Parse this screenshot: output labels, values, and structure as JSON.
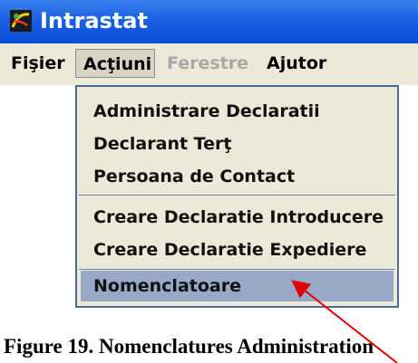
{
  "window": {
    "title": "Intrastat",
    "icon": "app-logo-icon"
  },
  "menubar": {
    "items": [
      {
        "label": "Fişier",
        "state": "normal"
      },
      {
        "label": "Acţiuni",
        "state": "open"
      },
      {
        "label": "Ferestre",
        "state": "disabled"
      },
      {
        "label": "Ajutor",
        "state": "normal"
      }
    ]
  },
  "dropdown": {
    "items": [
      {
        "label": "Administrare Declaratii"
      },
      {
        "label": "Declarant Terţ"
      },
      {
        "label": "Persoana de Contact"
      },
      {
        "label": "Creare Declaratie Introducere"
      },
      {
        "label": "Creare Declaratie Expediere"
      },
      {
        "label": "Nomenclatoare",
        "selected": true
      }
    ]
  },
  "caption": "Figure 19. Nomenclatures Administration",
  "colors": {
    "titlebar": "#1a5fe3",
    "menu_bg": "#ece9d8",
    "selection": "#98a9c7",
    "arrow": "#e00000"
  }
}
